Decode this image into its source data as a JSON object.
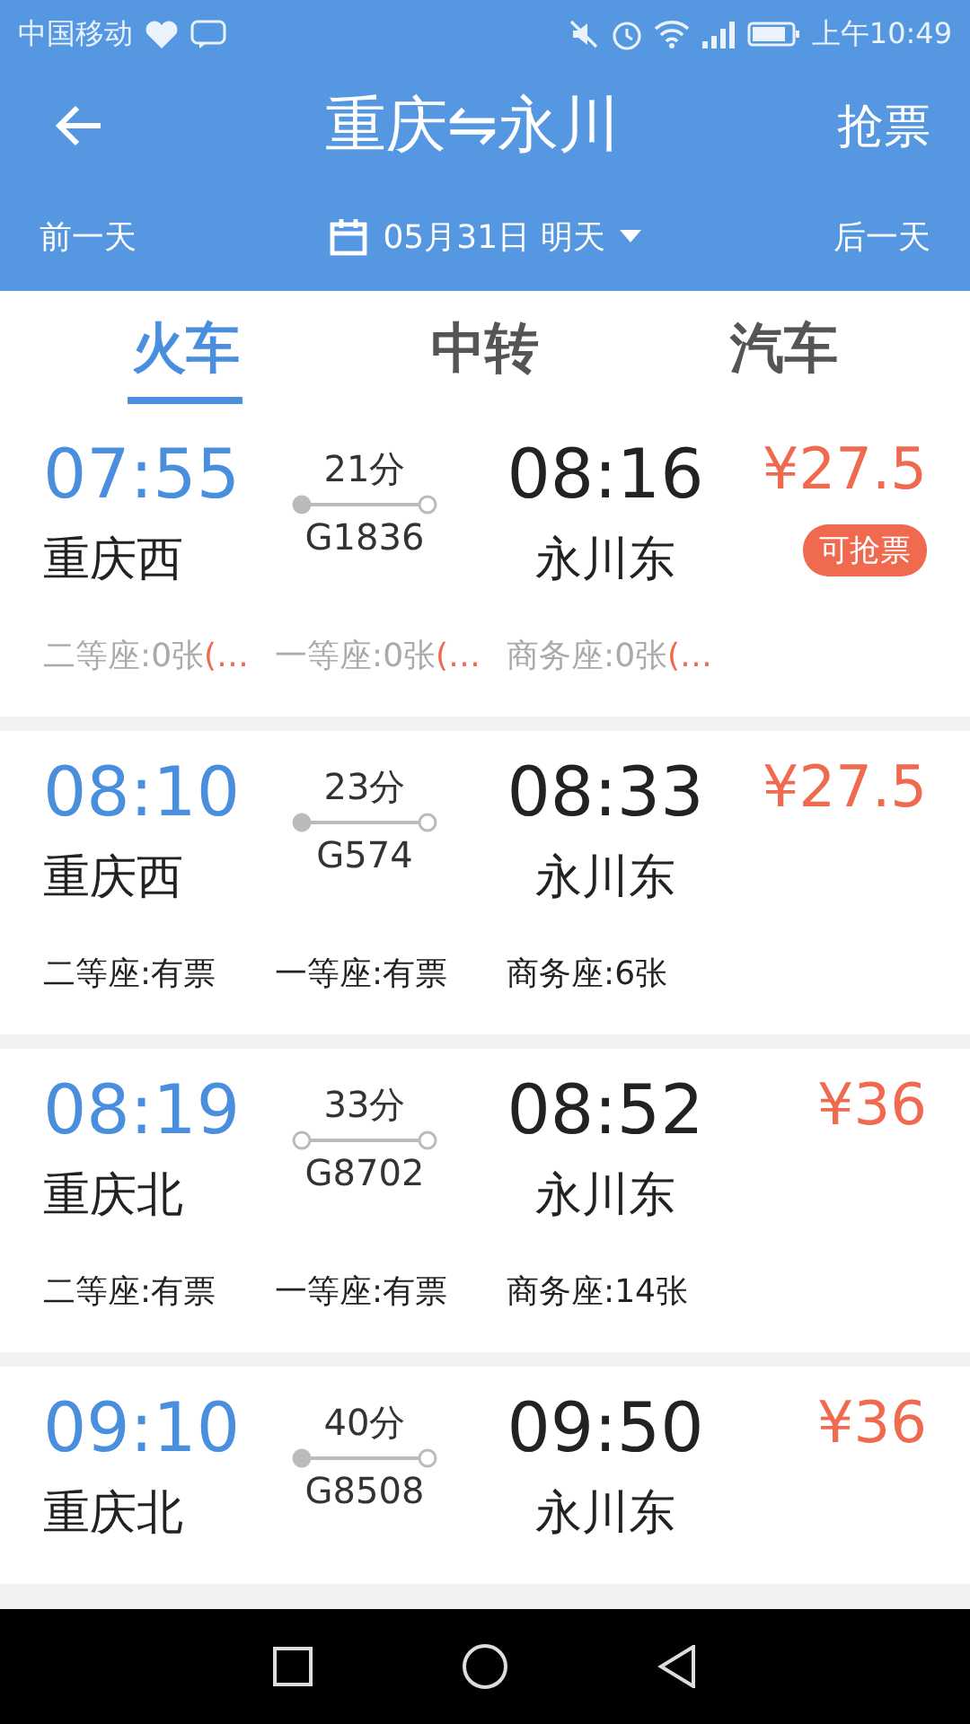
{
  "status_bar": {
    "carrier": "中国移动",
    "time": "上午10:49"
  },
  "header": {
    "title": "重庆⇋永川",
    "action": "抢票",
    "prev_day": "前一天",
    "date": "05月31日 明天",
    "next_day": "后一天"
  },
  "tabs": [
    {
      "label": "火车",
      "selected": true
    },
    {
      "label": "中转",
      "selected": false
    },
    {
      "label": "汽车",
      "selected": false
    }
  ],
  "trains": [
    {
      "depart_time": "07:55",
      "depart_station": "重庆西",
      "duration": "21分",
      "train_no": "G1836",
      "origin_station": true,
      "arrive_time": "08:16",
      "arrive_station": "永川东",
      "price": "¥27.5",
      "badge": "可抢票",
      "seats": [
        {
          "label": "二等座:0张",
          "note": "(…",
          "available": false
        },
        {
          "label": "一等座:0张",
          "note": "(…",
          "available": false
        },
        {
          "label": "商务座:0张",
          "note": "(…",
          "available": false
        }
      ]
    },
    {
      "depart_time": "08:10",
      "depart_station": "重庆西",
      "duration": "23分",
      "train_no": "G574",
      "origin_station": true,
      "arrive_time": "08:33",
      "arrive_station": "永川东",
      "price": "¥27.5",
      "seats": [
        {
          "label": "二等座:有票",
          "available": true
        },
        {
          "label": "一等座:有票",
          "available": true
        },
        {
          "label": "商务座:6张",
          "available": true
        }
      ]
    },
    {
      "depart_time": "08:19",
      "depart_station": "重庆北",
      "duration": "33分",
      "train_no": "G8702",
      "origin_station": false,
      "arrive_time": "08:52",
      "arrive_station": "永川东",
      "price": "¥36",
      "seats": [
        {
          "label": "二等座:有票",
          "available": true
        },
        {
          "label": "一等座:有票",
          "available": true
        },
        {
          "label": "商务座:14张",
          "available": true
        }
      ]
    },
    {
      "depart_time": "09:10",
      "depart_station": "重庆北",
      "duration": "40分",
      "train_no": "G8508",
      "origin_station": true,
      "arrive_time": "09:50",
      "arrive_station": "永川东",
      "price": "¥36"
    }
  ]
}
